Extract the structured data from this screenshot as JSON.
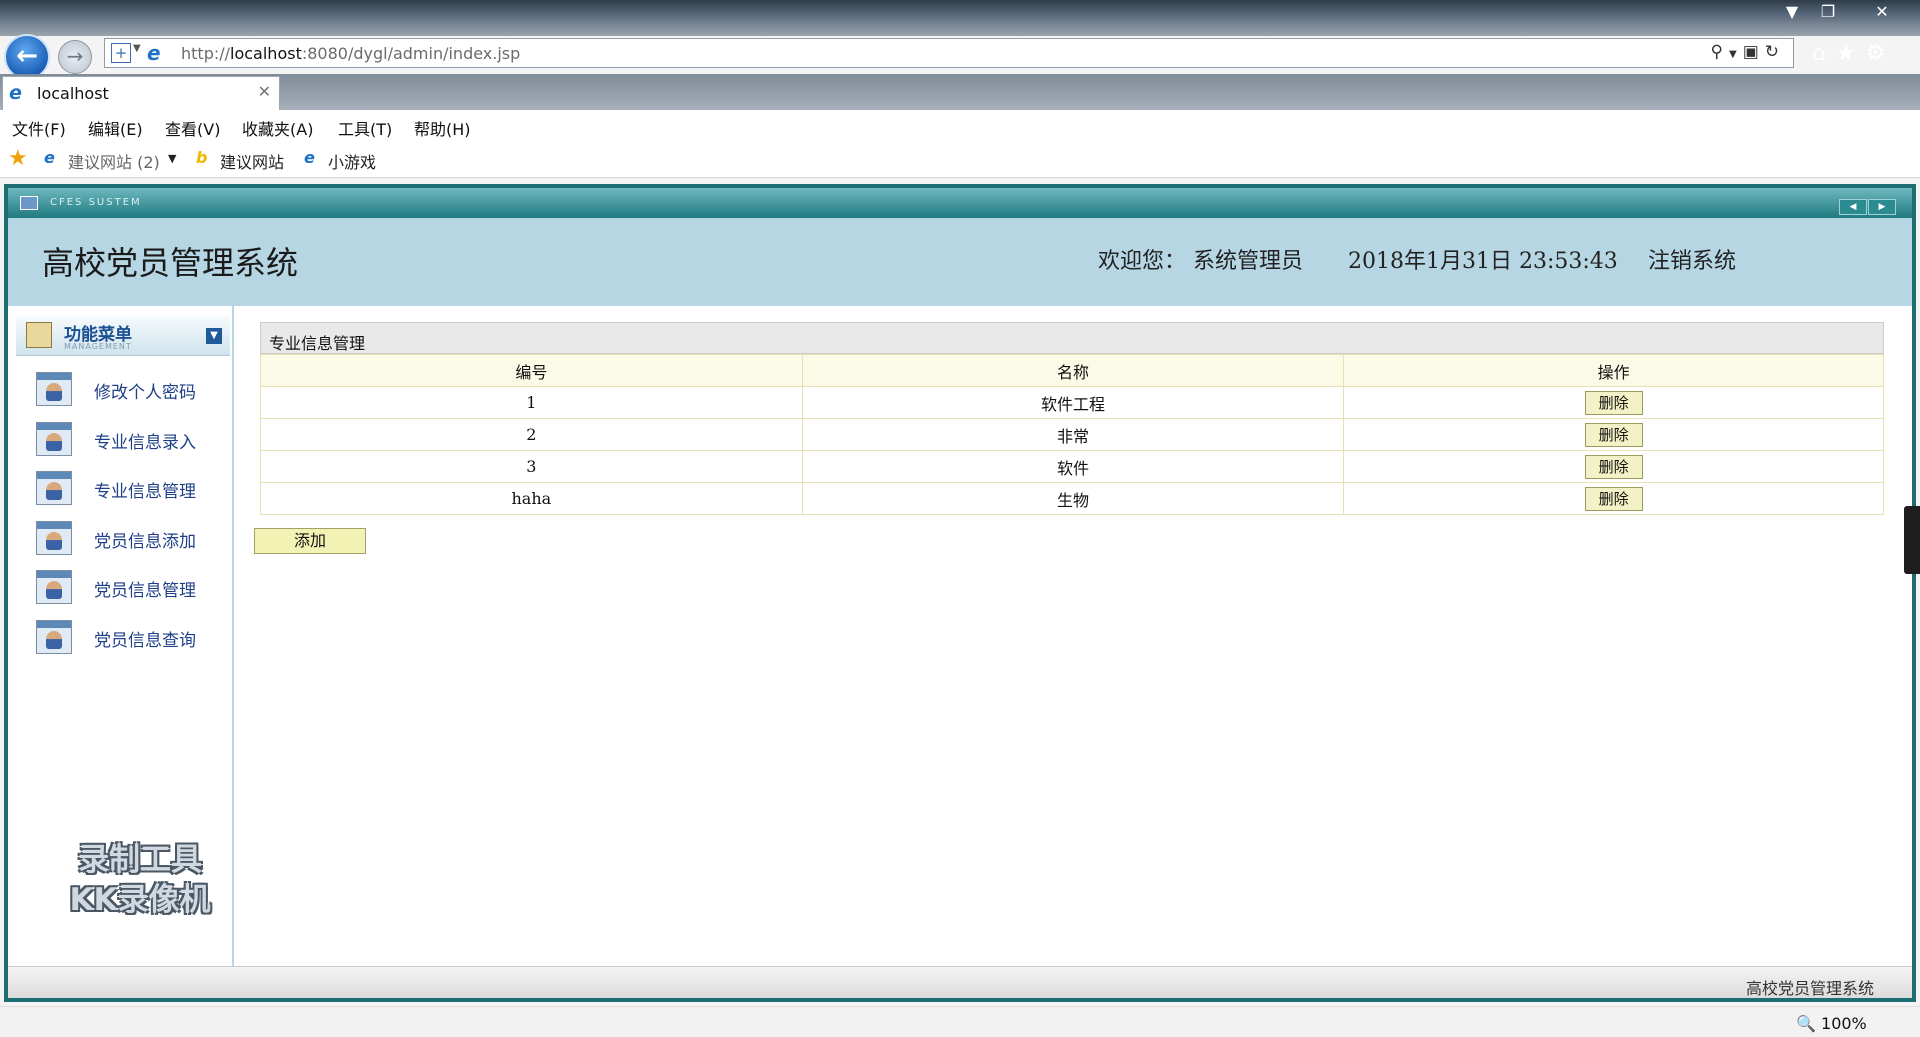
{
  "browser": {
    "url_prefix": "http://",
    "url_host": "localhost",
    "url_rest": ":8080/dygl/admin/index.jsp",
    "tab_title": "localhost",
    "menu": [
      "文件(F)",
      "编辑(E)",
      "查看(V)",
      "收藏夹(A)",
      "工具(T)",
      "帮助(H)"
    ],
    "favorites": {
      "suggested_sites_count": "建议网站 (2)",
      "suggested_sites": "建议网站",
      "mini_games": "小游戏"
    },
    "zoom": "100%"
  },
  "app": {
    "top_caption": "CFES SUSTEM",
    "title": "高校党员管理系统",
    "welcome": "欢迎您： 系统管理员",
    "datetime": "2018年1月31日 23:53:43",
    "logout": "注销系统",
    "footer": "高校党员管理系统"
  },
  "sidebar": {
    "title": "功能菜单",
    "subtitle": "MANAGEMENT",
    "items": [
      {
        "label": "修改个人密码"
      },
      {
        "label": "专业信息录入"
      },
      {
        "label": "专业信息管理"
      },
      {
        "label": "党员信息添加"
      },
      {
        "label": "党员信息管理"
      },
      {
        "label": "党员信息查询"
      }
    ]
  },
  "watermark": {
    "line1": "录制工具",
    "line2": "KK录像机"
  },
  "panel": {
    "title": "专业信息管理",
    "columns": [
      "编号",
      "名称",
      "操作"
    ],
    "rows": [
      {
        "id": "1",
        "name": "软件工程",
        "action": "删除"
      },
      {
        "id": "2",
        "name": "非常",
        "action": "删除"
      },
      {
        "id": "3",
        "name": "软件",
        "action": "删除"
      },
      {
        "id": "haha",
        "name": "生物",
        "action": "删除"
      }
    ],
    "add_label": "添加"
  }
}
